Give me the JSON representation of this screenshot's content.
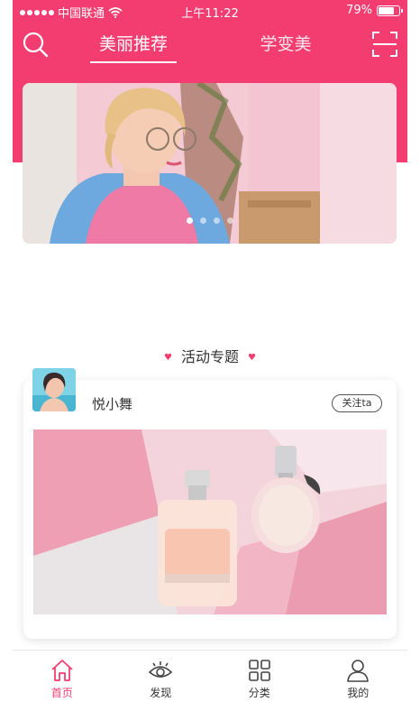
{
  "status_bar": {
    "carrier": "中国联通",
    "time": "上午11:22",
    "battery": "79%",
    "battery_level": 0.79
  },
  "nav": {
    "active_tab": "美丽推荐",
    "other_tab": "学变美"
  },
  "banner": {
    "dot_count": 4,
    "active_dot": 0
  },
  "section": {
    "title": "活动专题"
  },
  "card": {
    "username": "悦小舞",
    "follow_label": "关注ta"
  },
  "tabbar": {
    "items": [
      {
        "label": "首页",
        "icon": "home-icon",
        "active": true
      },
      {
        "label": "发现",
        "icon": "eye-icon",
        "active": false
      },
      {
        "label": "分类",
        "icon": "grid-icon",
        "active": false
      },
      {
        "label": "我的",
        "icon": "user-icon",
        "active": false
      }
    ]
  },
  "colors": {
    "accent": "#f33c70",
    "text": "#333333"
  }
}
